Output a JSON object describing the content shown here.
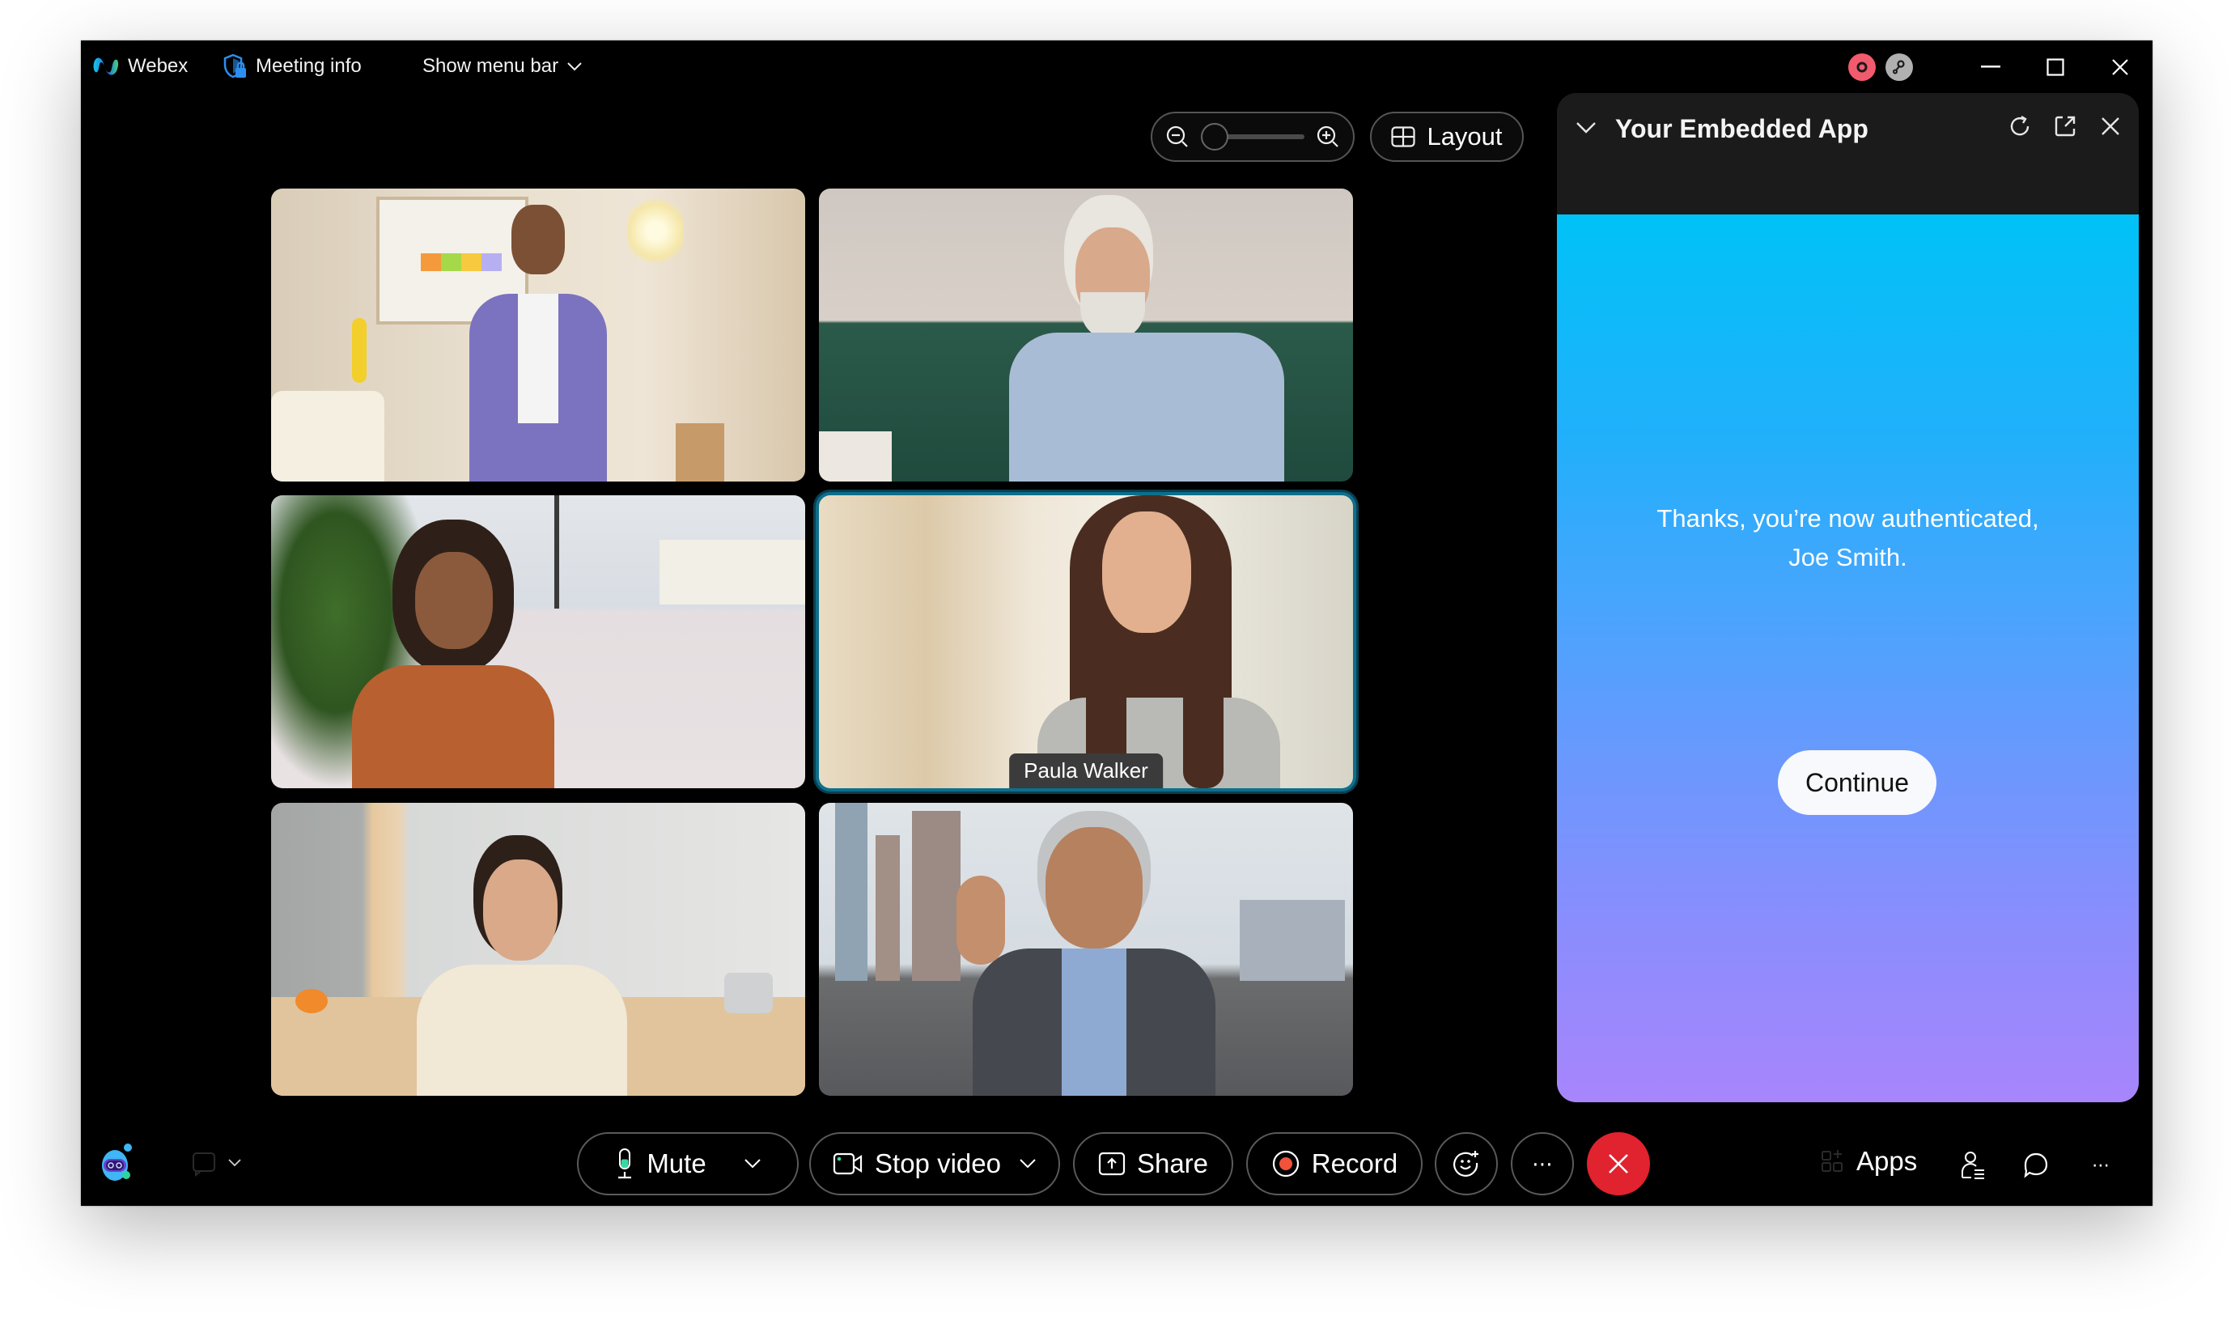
{
  "titlebar": {
    "app_name": "Webex",
    "meeting_info_label": "Meeting info",
    "show_menu_bar_label": "Show menu bar",
    "status_icons": [
      "recording-status-icon",
      "connection-status-icon"
    ],
    "window_controls": [
      "minimize",
      "maximize",
      "close"
    ]
  },
  "view_controls": {
    "zoom_level": 0,
    "layout_label": "Layout"
  },
  "participants": [
    {
      "name": "",
      "active_speaker": false,
      "scene": "bedroom"
    },
    {
      "name": "",
      "active_speaker": false,
      "scene": "living-room"
    },
    {
      "name": "",
      "active_speaker": false,
      "scene": "office"
    },
    {
      "name": "Paula Walker",
      "active_speaker": true,
      "scene": "home"
    },
    {
      "name": "",
      "active_speaker": false,
      "scene": "kitchen"
    },
    {
      "name": "",
      "active_speaker": false,
      "scene": "rooftop"
    }
  ],
  "embedded_app": {
    "title": "Your Embedded App",
    "message_line1": "Thanks, you’re now authenticated,",
    "message_line2": "Joe Smith.",
    "continue_label": "Continue",
    "gradient_top": "#00c2f7",
    "gradient_bottom": "#a885fc"
  },
  "toolbar": {
    "mute_label": "Mute",
    "stop_video_label": "Stop video",
    "share_label": "Share",
    "record_label": "Record",
    "more_label": "⋯",
    "apps_label": "Apps",
    "end_call_color": "#e0232f",
    "record_color": "#f0533a"
  }
}
